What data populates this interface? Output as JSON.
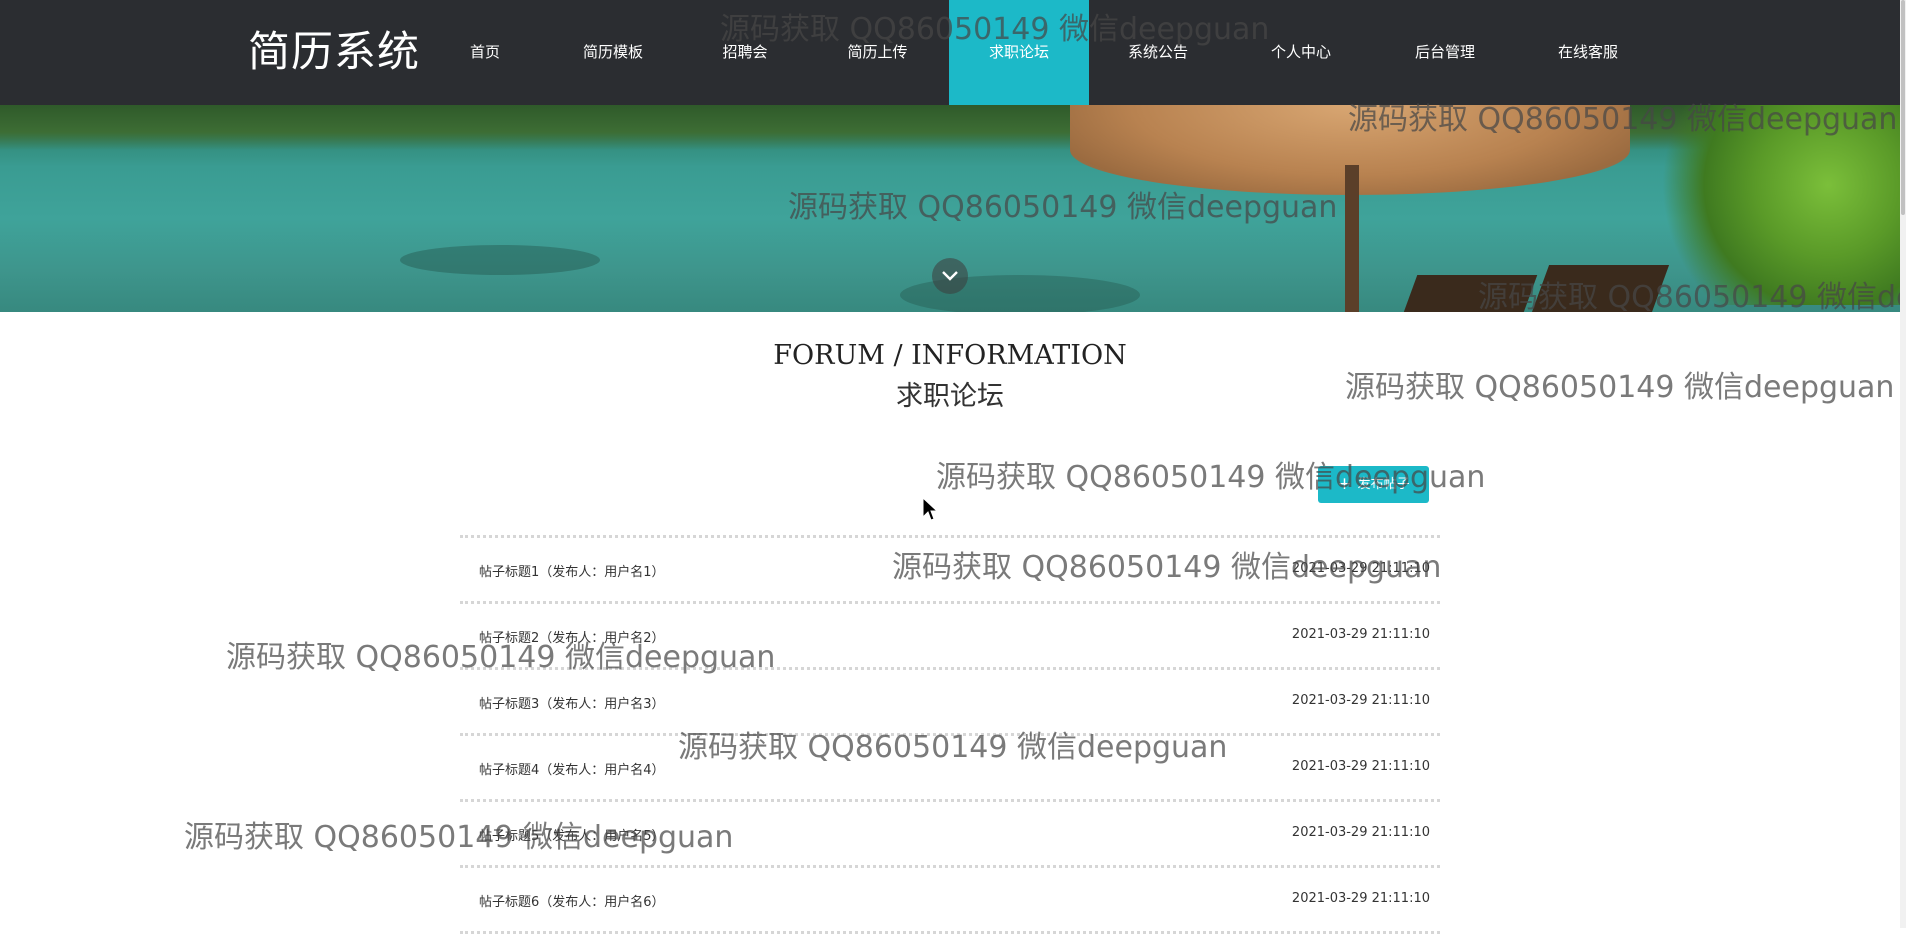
{
  "header": {
    "logo": "简历系统",
    "nav": [
      {
        "label": "首页"
      },
      {
        "label": "简历模板"
      },
      {
        "label": "招聘会"
      },
      {
        "label": "简历上传"
      },
      {
        "label": "求职论坛"
      },
      {
        "label": "系统公告"
      },
      {
        "label": "个人中心"
      },
      {
        "label": "后台管理"
      },
      {
        "label": "在线客服"
      }
    ],
    "active_index": 4
  },
  "section": {
    "title_en": "FORUM / INFORMATION",
    "title_cn": "求职论坛"
  },
  "post_button": {
    "label": "发布帖子"
  },
  "posts": [
    {
      "title": "帖子标题1（发布人：用户名1）",
      "date": "2021-03-29 21:11:10"
    },
    {
      "title": "帖子标题2（发布人：用户名2）",
      "date": "2021-03-29 21:11:10"
    },
    {
      "title": "帖子标题3（发布人：用户名3）",
      "date": "2021-03-29 21:11:10"
    },
    {
      "title": "帖子标题4（发布人：用户名4）",
      "date": "2021-03-29 21:11:10"
    },
    {
      "title": "帖子标题5（发布人：用户名5）",
      "date": "2021-03-29 21:11:10"
    },
    {
      "title": "帖子标题6（发布人：用户名6）",
      "date": "2021-03-29 21:11:10"
    }
  ],
  "watermark": "源码获取 QQ86050149 微信deepguan",
  "colors": {
    "accent": "#1cb9c8",
    "header_bg": "#2b2d31"
  }
}
